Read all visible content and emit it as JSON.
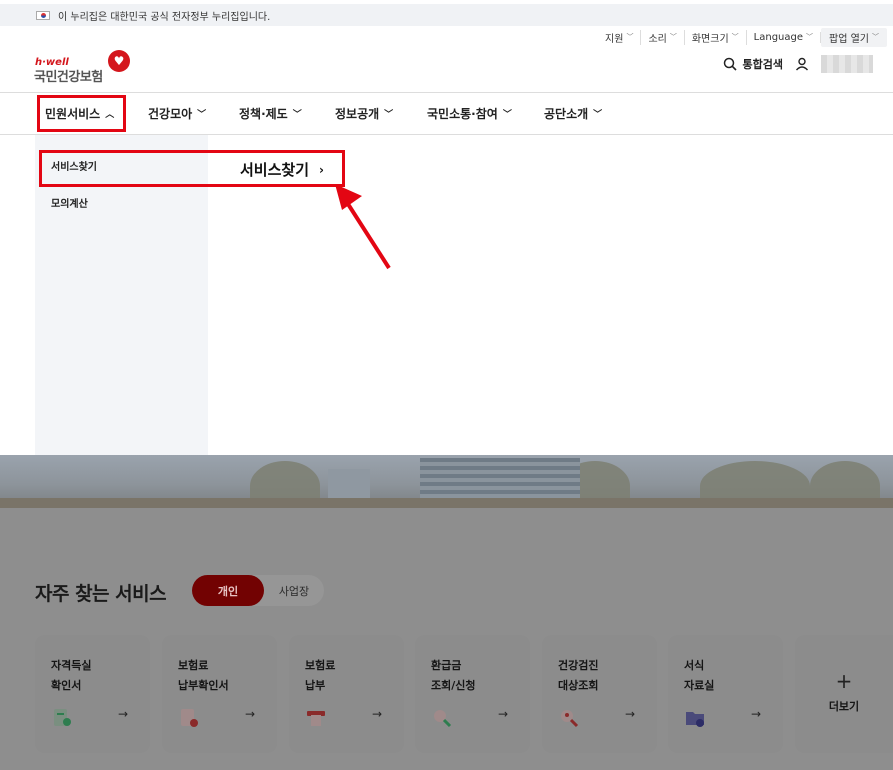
{
  "gov_bar": {
    "text": "이 누리집은 대한민국 공식 전자정부 누리집입니다."
  },
  "util": {
    "items": [
      {
        "label": "지원"
      },
      {
        "label": "소리"
      },
      {
        "label": "화면크기"
      },
      {
        "label": "Language"
      }
    ],
    "popup_label": "팝업 열기"
  },
  "logo": {
    "brand": "h·well",
    "name": "국민건강보험"
  },
  "header": {
    "search_label": "통합검색"
  },
  "gnb": [
    {
      "label": "민원서비스",
      "chev": "︿"
    },
    {
      "label": "건강모아",
      "chev": "﹀"
    },
    {
      "label": "정책·제도",
      "chev": "﹀"
    },
    {
      "label": "정보공개",
      "chev": "﹀"
    },
    {
      "label": "국민소통·참여",
      "chev": "﹀"
    },
    {
      "label": "공단소개",
      "chev": "﹀"
    }
  ],
  "submenu": {
    "items": [
      {
        "label": "서비스찾기"
      },
      {
        "label": "모의계산"
      }
    ],
    "detail_title": "서비스찾기",
    "detail_chev": "›"
  },
  "faq": {
    "title": "자주 찾는 서비스",
    "toggle": {
      "active": "개인",
      "inactive": "사업장"
    },
    "cards": [
      {
        "line1": "자격득실",
        "line2": "확인서",
        "icon": "certificate-icon",
        "icon_color": "#2e7d4f"
      },
      {
        "line1": "보험료",
        "line2": "납부확인서",
        "icon": "receipt-icon",
        "icon_color": "#b33a3a"
      },
      {
        "line1": "보험료",
        "line2": "납부",
        "icon": "payment-icon",
        "icon_color": "#b33a3a"
      },
      {
        "line1": "환급금",
        "line2": "조회/신청",
        "icon": "refund-search-icon",
        "icon_color": "#2e7d4f"
      },
      {
        "line1": "건강검진",
        "line2": "대상조회",
        "icon": "checkup-search-icon",
        "icon_color": "#b33a3a"
      },
      {
        "line1": "서식",
        "line2": "자료실",
        "icon": "folder-download-icon",
        "icon_color": "#3b3b8a"
      }
    ],
    "arrow": "→",
    "more": {
      "plus": "+",
      "label": "더보기"
    }
  },
  "colors": {
    "brand": "#d4161c",
    "highlight": "#e30613",
    "toggle_active": "#720202"
  }
}
